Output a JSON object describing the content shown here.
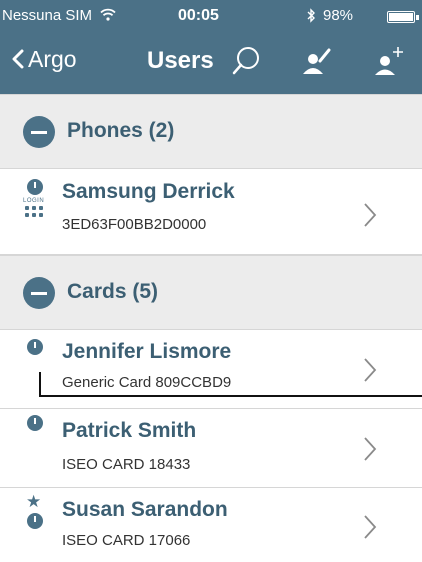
{
  "status_bar": {
    "carrier": "Nessuna SIM",
    "time": "00:05",
    "battery": "98%",
    "battery_level": 0.98
  },
  "nav": {
    "back_label": "Argo",
    "title": "Users"
  },
  "sections": [
    {
      "title": "Phones (2)",
      "items": [
        {
          "name": "Samsung Derrick",
          "subtitle": "3ED63F00BB2D0000",
          "login_label": "LOGIN"
        }
      ]
    },
    {
      "title": "Cards (5)",
      "items": [
        {
          "name": "Jennifer Lismore",
          "subtitle": "Generic Card 809CCBD9"
        },
        {
          "name": "Patrick Smith",
          "subtitle": "ISEO CARD 18433"
        },
        {
          "name": "Susan Sarandon",
          "subtitle": "ISEO CARD 17066"
        }
      ]
    }
  ],
  "icons": {
    "back": "chevron-left-icon",
    "search": "search-icon",
    "edit_user": "edit-user-icon",
    "add_user": "add-user-icon",
    "schedule": "clock-icon",
    "login": "login-keypad-icon",
    "favorite": "star-icon",
    "disclosure": "chevron-right-icon",
    "section_toggle": "minus-circle-icon"
  },
  "colors": {
    "header": "#4b7187",
    "section_background": "#ececec",
    "accent_text": "#3c5f73"
  }
}
